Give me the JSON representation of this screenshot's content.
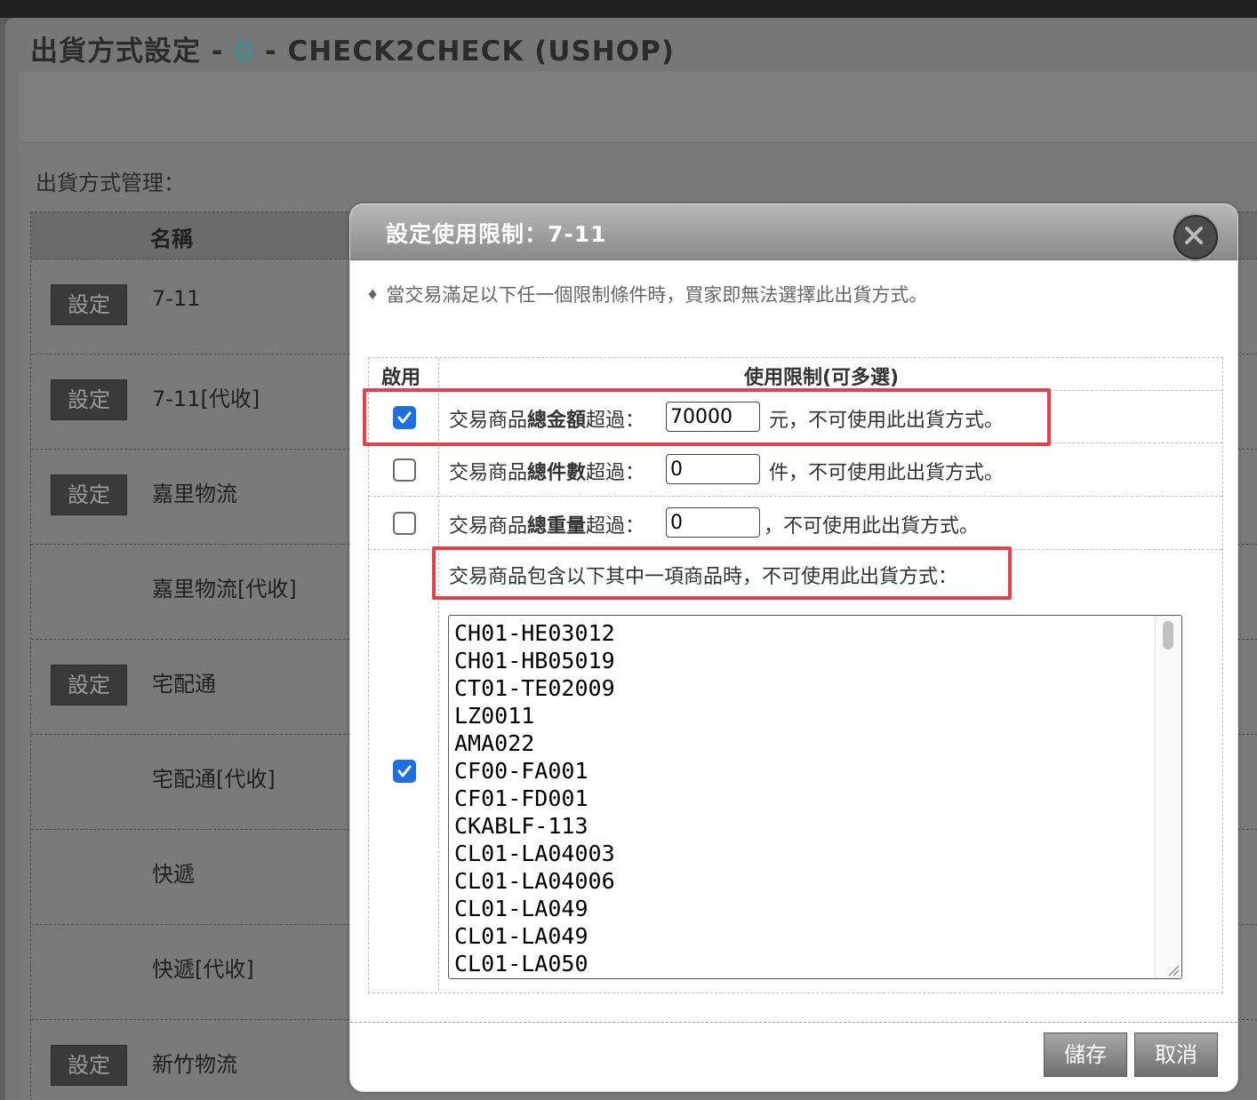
{
  "window": {
    "title_prefix": "出貨方式設定 - ",
    "title_num": "0",
    "title_suffix": " - CHECK2CHECK (USHOP)"
  },
  "manager": {
    "label": "出貨方式管理：",
    "header_name": "名稱",
    "config_label": "設定",
    "rows": [
      {
        "name": "7-11",
        "has_button": true
      },
      {
        "name": "7-11[代收]",
        "has_button": true
      },
      {
        "name": "嘉里物流",
        "has_button": true
      },
      {
        "name": "嘉里物流[代收]",
        "has_button": false
      },
      {
        "name": "宅配通",
        "has_button": true
      },
      {
        "name": "宅配通[代收]",
        "has_button": false
      },
      {
        "name": "快遞",
        "has_button": false
      },
      {
        "name": "快遞[代收]",
        "has_button": false
      },
      {
        "name": "新竹物流",
        "has_button": true
      }
    ]
  },
  "modal": {
    "title": "設定使用限制：7-11",
    "close_icon": "close-circle-icon",
    "notice": "當交易滿足以下任一個限制條件時，買家即無法選擇此出貨方式。",
    "col_enable": "啟用",
    "col_limit": "使用限制(可多選)",
    "limits": {
      "amount": {
        "checked": true,
        "prefix": "交易商品",
        "bold": "總金額",
        "mid": "超過：",
        "value": "70000",
        "suffix": "元，不可使用此出貨方式。"
      },
      "count": {
        "checked": false,
        "prefix": "交易商品",
        "bold": "總件數",
        "mid": "超過：",
        "value": "0",
        "suffix": "件，不可使用此出貨方式。"
      },
      "weight": {
        "checked": false,
        "prefix": "交易商品",
        "bold": "總重量",
        "mid": "超過：",
        "value": "0",
        "suffix": "，不可使用此出貨方式。"
      },
      "products": {
        "checked": true,
        "text": "交易商品包含以下其中一項商品時，不可使用此出貨方式：",
        "items": [
          "CH01-HE03012",
          "CH01-HB05019",
          "CT01-TE02009",
          "LZ0011",
          "AMA022",
          "CF00-FA001",
          "CF01-FD001",
          "CKABLF-113",
          "CL01-LA04003",
          "CL01-LA04006",
          "CL01-LA049",
          "CL01-LA049",
          "CL01-LA050"
        ]
      }
    },
    "save_label": "儲存",
    "cancel_label": "取消"
  },
  "colors": {
    "highlight": "#e8404a",
    "checkbox": "#1f6fe0",
    "title_num": "#4a8a92"
  }
}
